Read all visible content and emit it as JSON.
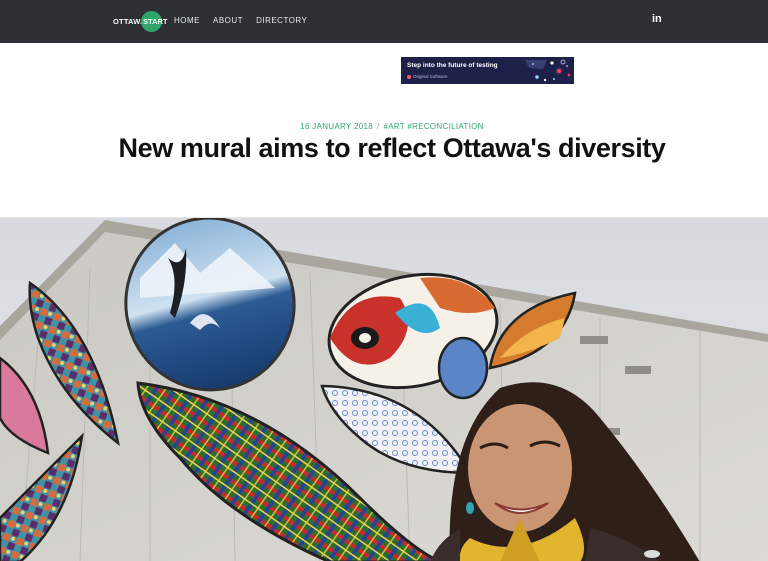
{
  "nav": {
    "logo_text": "OTTAWA",
    "logo_badge": "START",
    "items": [
      "HOME",
      "ABOUT",
      "DIRECTORY"
    ],
    "social_icon": "linkedin-icon",
    "social_label": "in",
    "colors": {
      "bar": "#2d2f32",
      "accent": "#2ea66b"
    }
  },
  "ad": {
    "headline": "Step into the future of testing",
    "brand": "Original Software"
  },
  "article": {
    "date": "16 JANUARY 2018",
    "separator": "/",
    "tags": "#ART #RECONCILIATION",
    "title": "New mural aims to reflect Ottawa's diversity"
  },
  "hero": {
    "subject": "mural-photo"
  }
}
